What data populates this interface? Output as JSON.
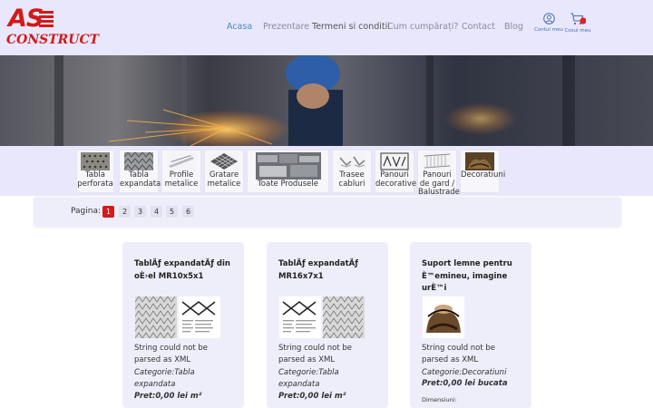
{
  "logo": {
    "as": "AS",
    "construct": "CONSTRUCT"
  },
  "nav": [
    {
      "label": "Acasa"
    },
    {
      "label": "Prezentare"
    },
    {
      "label": "Termeni si conditii"
    },
    {
      "label": "Cum cumpărați?"
    },
    {
      "label": "Contact"
    },
    {
      "label": "Blog"
    }
  ],
  "account": {
    "label": "Contul meu"
  },
  "cart": {
    "label": "Cosul meu"
  },
  "categories": [
    {
      "label": "Tabla perforata"
    },
    {
      "label": "Tabla expandata"
    },
    {
      "label": "Profile metalice"
    },
    {
      "label": "Gratare metalice"
    },
    {
      "label": "Toate Produsele"
    },
    {
      "label": "Trasee cabluri"
    },
    {
      "label": "Panouri decorative"
    },
    {
      "label": "Panouri de gard / Balustrade"
    },
    {
      "label": "Decoratiuni"
    }
  ],
  "pagination": {
    "label": "Pagina:",
    "pages": [
      "1",
      "2",
      "3",
      "4",
      "5",
      "6"
    ],
    "current": "1"
  },
  "products": [
    {
      "title": "TablÄƒ expandatÄƒ din oÈ›el MR10x5x1",
      "error": "String could not be parsed as XML",
      "category": "Categorie:Tabla expandata",
      "price": "Pret:0,00 lei m²"
    },
    {
      "title": "TablÄƒ expandatÄƒ MR16x7x1",
      "error": "String could not be parsed as XML",
      "category": "Categorie:Tabla expandata",
      "price": "Pret:0,00 lei m²"
    },
    {
      "title": "Suport lemne pentru È™emineu, imagine urÈ™i",
      "error": "String could not be parsed as XML",
      "category": "Categorie:Decoratiuni",
      "price": "Pret:0,00 lei bucata",
      "dims_label": "Dimensiuni:"
    }
  ],
  "colors": {
    "brand_red": "#d31919",
    "nav_active": "#4b86c6",
    "header_bg": "#e8e7fb",
    "card_bg": "#eeeefb"
  }
}
